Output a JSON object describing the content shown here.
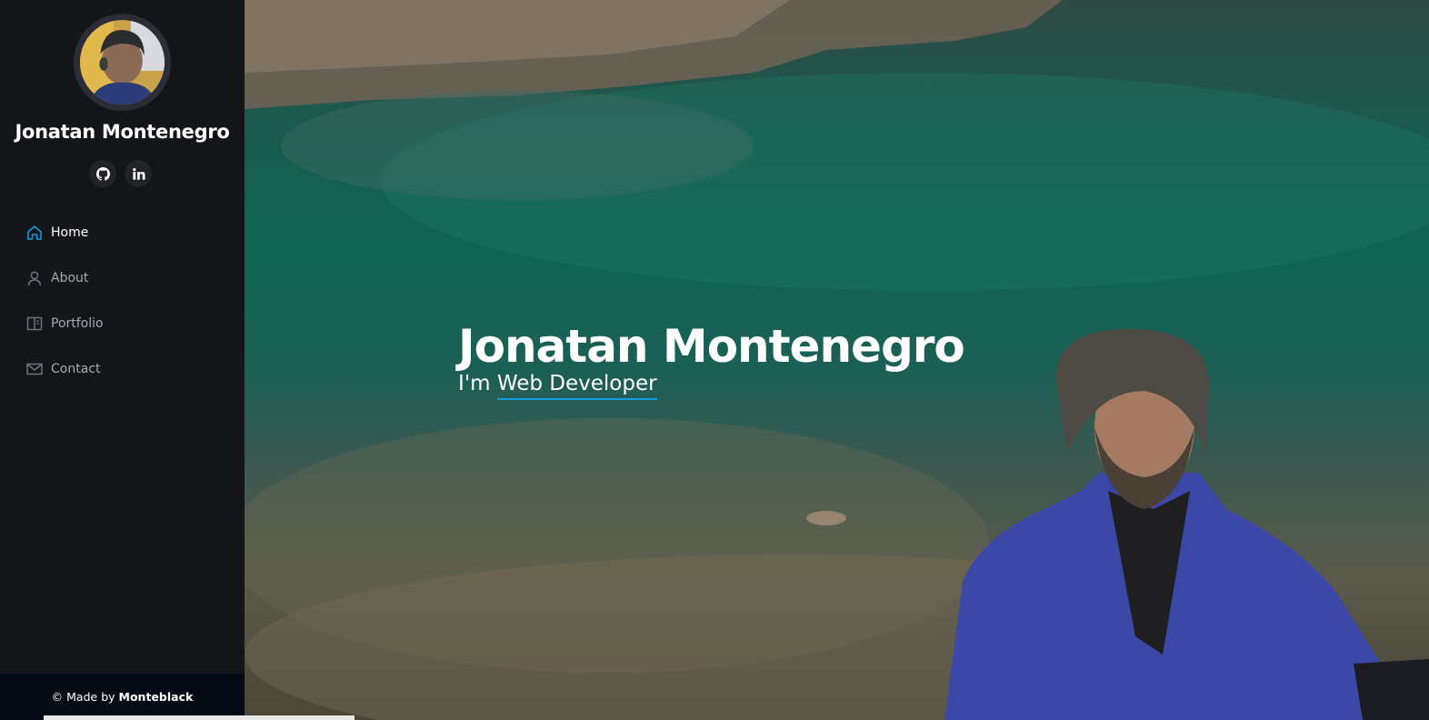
{
  "profile": {
    "name": "Jonatan Montenegro",
    "avatar_icon": "profile-photo"
  },
  "social": [
    {
      "name": "github",
      "icon": "github-icon"
    },
    {
      "name": "linkedin",
      "icon": "linkedin-icon",
      "text": "in"
    }
  ],
  "nav": {
    "items": [
      {
        "label": "Home",
        "icon": "home-icon",
        "active": true
      },
      {
        "label": "About",
        "icon": "user-icon",
        "active": false
      },
      {
        "label": "Portfolio",
        "icon": "portfolio-icon",
        "active": false
      },
      {
        "label": "Contact",
        "icon": "envelope-icon",
        "active": false
      }
    ]
  },
  "footer": {
    "prefix": "© Made by",
    "author": "Monteblack"
  },
  "hero": {
    "title": "Jonatan Montenegro",
    "subtitle_prefix": "I'm ",
    "subtitle_typed": "Web Developer"
  },
  "colors": {
    "accent": "#149ddd",
    "sidebar_bg": "#141518",
    "footer_bg": "#040b14"
  }
}
